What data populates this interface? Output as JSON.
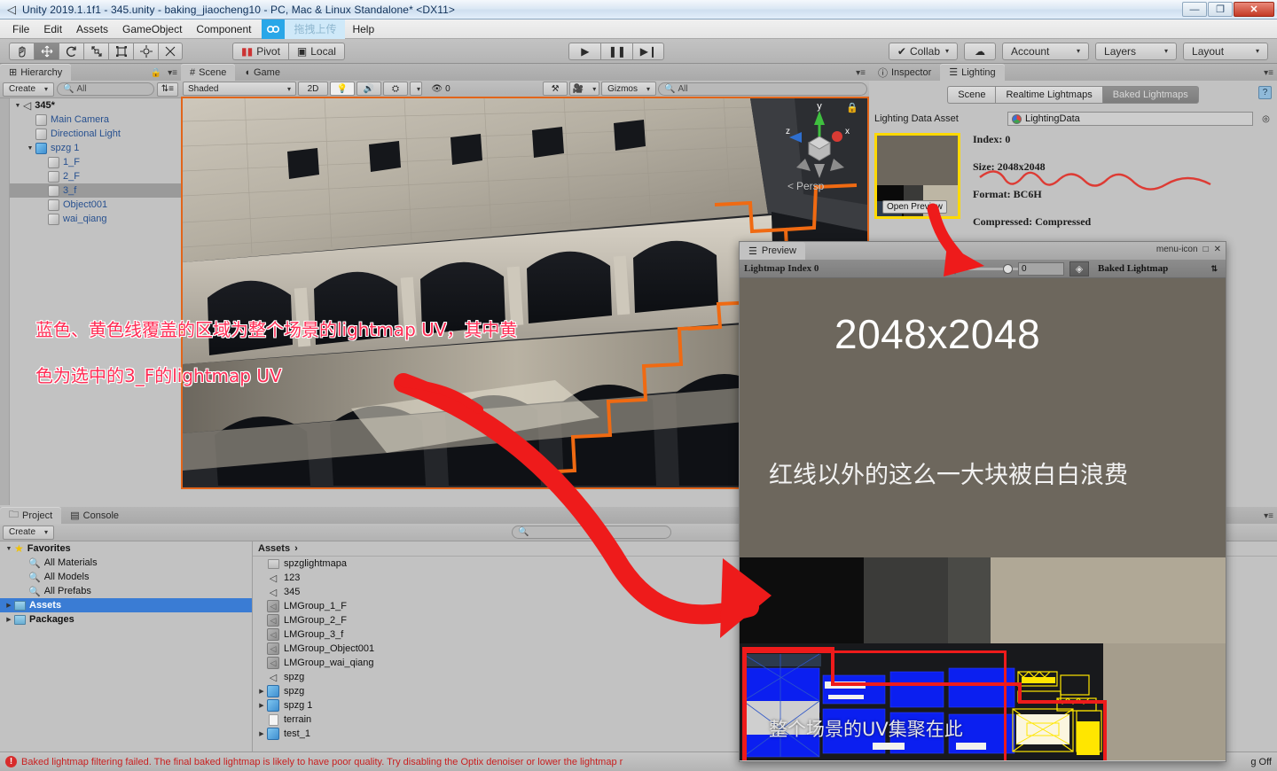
{
  "window": {
    "title": "Unity 2019.1.1f1 - 345.unity - baking_jiaocheng10 - PC, Mac & Linux Standalone* <DX11>",
    "minimize": "—",
    "maximize": "❐",
    "close": "✕"
  },
  "menu": {
    "items": [
      "File",
      "Edit",
      "Assets",
      "GameObject",
      "Component"
    ],
    "upload_label": "拖拽上传",
    "upload_icon": "cloud-upload-icon",
    "help": "Help"
  },
  "toolbar": {
    "transform_tools": [
      {
        "name": "hand-tool",
        "glyph": "✋",
        "active": false
      },
      {
        "name": "move-tool",
        "glyph": "✥",
        "active": true
      },
      {
        "name": "rotate-tool",
        "glyph": "⟳",
        "active": false
      },
      {
        "name": "scale-tool",
        "glyph": "⤢",
        "active": false
      },
      {
        "name": "rect-tool",
        "glyph": "◫",
        "active": false
      },
      {
        "name": "transform-tool",
        "glyph": "✛",
        "active": false
      },
      {
        "name": "custom-tool",
        "glyph": "⚒",
        "active": false
      }
    ],
    "pivot_label": "Pivot",
    "local_label": "Local",
    "play_label": "▶",
    "pause_label": "❚❚",
    "step_label": "▶❙",
    "collab_label": "Collab",
    "cloud_label": "☁",
    "account_label": "Account",
    "layers_label": "Layers",
    "layout_label": "Layout"
  },
  "hierarchy": {
    "tab_label": "Hierarchy",
    "create_label": "Create",
    "search_placeholder": "All",
    "root": "345*",
    "items": [
      {
        "label": "Main Camera",
        "depth": 1,
        "type": "go",
        "selected": false,
        "expandable": false
      },
      {
        "label": "Directional Light",
        "depth": 1,
        "type": "go",
        "selected": false,
        "expandable": false
      },
      {
        "label": "spzg 1",
        "depth": 1,
        "type": "prefab",
        "selected": false,
        "expandable": true
      },
      {
        "label": "1_F",
        "depth": 2,
        "type": "go",
        "selected": false,
        "expandable": false
      },
      {
        "label": "2_F",
        "depth": 2,
        "type": "go",
        "selected": false,
        "expandable": false
      },
      {
        "label": "3_f",
        "depth": 2,
        "type": "go",
        "selected": true,
        "expandable": false
      },
      {
        "label": "Object001",
        "depth": 2,
        "type": "go",
        "selected": false,
        "expandable": false
      },
      {
        "label": "wai_qiang",
        "depth": 2,
        "type": "go",
        "selected": false,
        "expandable": false
      }
    ]
  },
  "scene": {
    "tabs": [
      {
        "label": "Scene",
        "icon": "grid-icon",
        "active": true
      },
      {
        "label": "Game",
        "icon": "gamepad-icon",
        "active": false
      }
    ],
    "shading_mode": "Shaded",
    "mode_2d": "2D",
    "light_icon": "lightbulb-icon",
    "audio_icon": "speaker-icon",
    "fx_icon": "effects-icon",
    "hidden_count": "0",
    "tools_icon": "tools-icon",
    "camera_icon": "camera-icon",
    "gizmos_label": "Gizmos",
    "gizmo_search_placeholder": "All",
    "view_gizmo": {
      "x": "x",
      "y": "y",
      "z": "z",
      "mode": "Persp"
    },
    "annotation_line1": "蓝色、黄色线覆盖的区域为整个场景的lightmap UV，其中黄",
    "annotation_line2": "色为选中的3_F的lightmap UV"
  },
  "inspector": {
    "tabs": [
      {
        "label": "Inspector",
        "icon": "info-icon",
        "active": false
      },
      {
        "label": "Lighting",
        "icon": "lighting-icon",
        "active": true
      }
    ],
    "segments": [
      {
        "label": "Scene",
        "active": false
      },
      {
        "label": "Realtime Lightmaps",
        "active": false
      },
      {
        "label": "Baked Lightmaps",
        "active": true
      }
    ],
    "data_asset_label": "Lighting Data Asset",
    "data_asset_value": "LightingData",
    "lightmap": {
      "index": "Index: 0",
      "size": "Size: 2048x2048",
      "format": "Format: BC6H",
      "compressed": "Compressed: Compressed",
      "open_preview": "Open Preview"
    },
    "help_icon": "help-icon"
  },
  "project": {
    "tabs": [
      {
        "label": "Project",
        "icon": "folder-icon",
        "active": true
      },
      {
        "label": "Console",
        "icon": "console-icon",
        "active": false
      }
    ],
    "create_label": "Create",
    "search_placeholder": "",
    "tree": [
      {
        "label": "Favorites",
        "type": "favorites",
        "depth": 0,
        "bold": true,
        "expandable": true,
        "selected": false
      },
      {
        "label": "All Materials",
        "type": "search",
        "depth": 1,
        "bold": false,
        "expandable": false,
        "selected": false
      },
      {
        "label": "All Models",
        "type": "search",
        "depth": 1,
        "bold": false,
        "expandable": false,
        "selected": false
      },
      {
        "label": "All Prefabs",
        "type": "search",
        "depth": 1,
        "bold": false,
        "expandable": false,
        "selected": false
      },
      {
        "label": "Assets",
        "type": "folder",
        "depth": 0,
        "bold": true,
        "expandable": true,
        "selected": true
      },
      {
        "label": "Packages",
        "type": "folder",
        "depth": 0,
        "bold": true,
        "expandable": true,
        "selected": false
      }
    ],
    "breadcrumb": "Assets",
    "breadcrumb_sep": "›",
    "assets": [
      {
        "label": "spzglightmapa",
        "type": "folder",
        "expandable": false
      },
      {
        "label": "123",
        "type": "scene",
        "expandable": false
      },
      {
        "label": "345",
        "type": "scene",
        "expandable": false
      },
      {
        "label": "LMGroup_1_F",
        "type": "lightmap",
        "expandable": false
      },
      {
        "label": "LMGroup_2_F",
        "type": "lightmap",
        "expandable": false
      },
      {
        "label": "LMGroup_3_f",
        "type": "lightmap",
        "expandable": false
      },
      {
        "label": "LMGroup_Object001",
        "type": "lightmap",
        "expandable": false
      },
      {
        "label": "LMGroup_wai_qiang",
        "type": "lightmap",
        "expandable": false
      },
      {
        "label": "spzg",
        "type": "scene",
        "expandable": false
      },
      {
        "label": "spzg",
        "type": "prefab",
        "expandable": true
      },
      {
        "label": "spzg 1",
        "type": "prefab",
        "expandable": true
      },
      {
        "label": "terrain",
        "type": "file",
        "expandable": false
      },
      {
        "label": "test_1",
        "type": "prefab",
        "expandable": true
      }
    ]
  },
  "preview": {
    "tab_label": "Preview",
    "tab_icon": "lighting-icon",
    "menu_icon": "menu-icon",
    "maximize_icon": "□",
    "close_icon": "✕",
    "index_label": "Lightmap Index 0",
    "slider_value": "0",
    "numfield_value": "0",
    "layers_icon": "layers-icon",
    "mode_label": "Baked Lightmap",
    "mode_caret": "⇅",
    "size_text": "2048x2048",
    "note_text": "红线以外的这么一大块被白白浪费",
    "uv_text": "整个场景的UV集聚在此"
  },
  "status": {
    "icon": "error-icon",
    "message": "Baked lightmap filtering failed. The final baked lightmap is likely to have poor quality. Try disabling the Optix denoiser or lower the lightmap r",
    "right_text": "g Off"
  },
  "colors": {
    "accent_orange": "#e2651a",
    "annotation_red": "#ff2d55",
    "arrow_red": "#ee1b1b",
    "selection_blue": "#3a7cd4",
    "highlight_yellow": "#ffd900",
    "uv_blue": "#0b1ff0",
    "uv_yellow": "#ffe600"
  }
}
